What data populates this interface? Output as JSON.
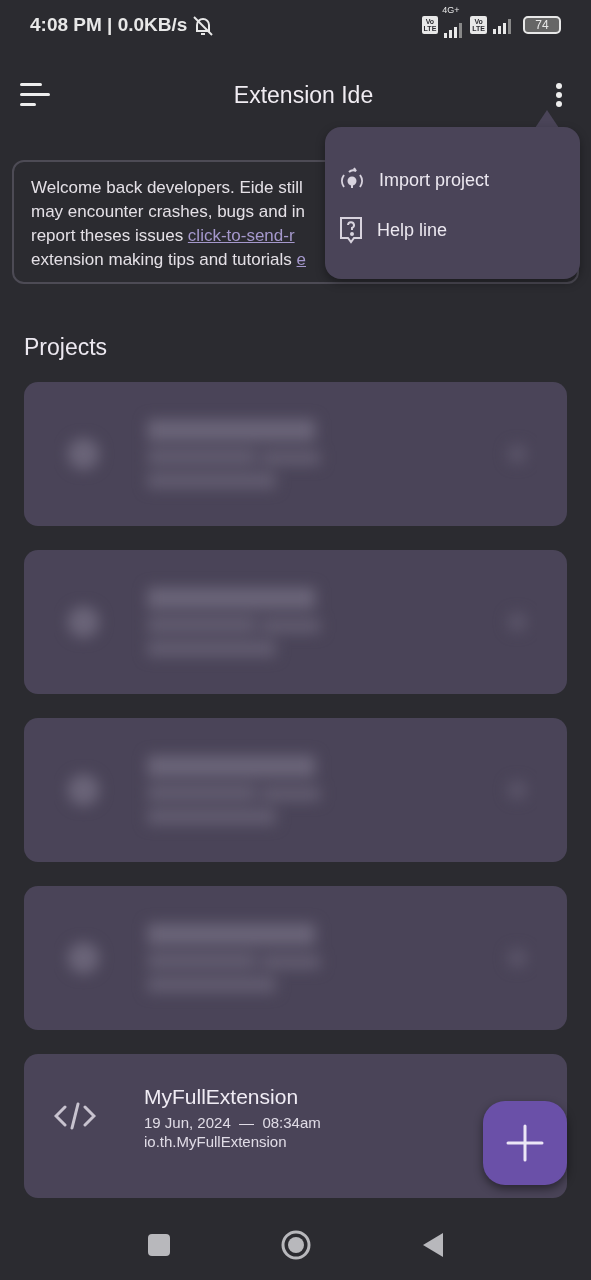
{
  "status_bar": {
    "time_speed": "4:08 PM | 0.0KB/s",
    "sim1_badge": [
      "Vo",
      "LTE"
    ],
    "network_type": "4G+",
    "sim2_badge": [
      "Vo",
      "LTE"
    ],
    "battery": "74"
  },
  "app_bar": {
    "title": "Extension Ide"
  },
  "banner": {
    "lines": [
      {
        "text": "Welcome back developers. Eide still"
      },
      {
        "text": "may encounter crashes, bugs and in"
      },
      {
        "text": "report theses issues ",
        "link": "click-to-send-r"
      },
      {
        "text": "extension making tips and tutorials ",
        "link": "e"
      }
    ]
  },
  "section_title": "Projects",
  "projects": [
    {
      "kind": "blurred"
    },
    {
      "kind": "blurred"
    },
    {
      "kind": "blurred"
    },
    {
      "kind": "blurred"
    },
    {
      "kind": "project",
      "name": "MyFullExtension",
      "modified": "19 Jun, 2024  —  08:34am",
      "package": "io.th.MyFullExtension"
    }
  ],
  "menu": {
    "items": [
      {
        "kind": "import",
        "label": "Import project"
      },
      {
        "kind": "help",
        "label": "Help line"
      }
    ]
  }
}
